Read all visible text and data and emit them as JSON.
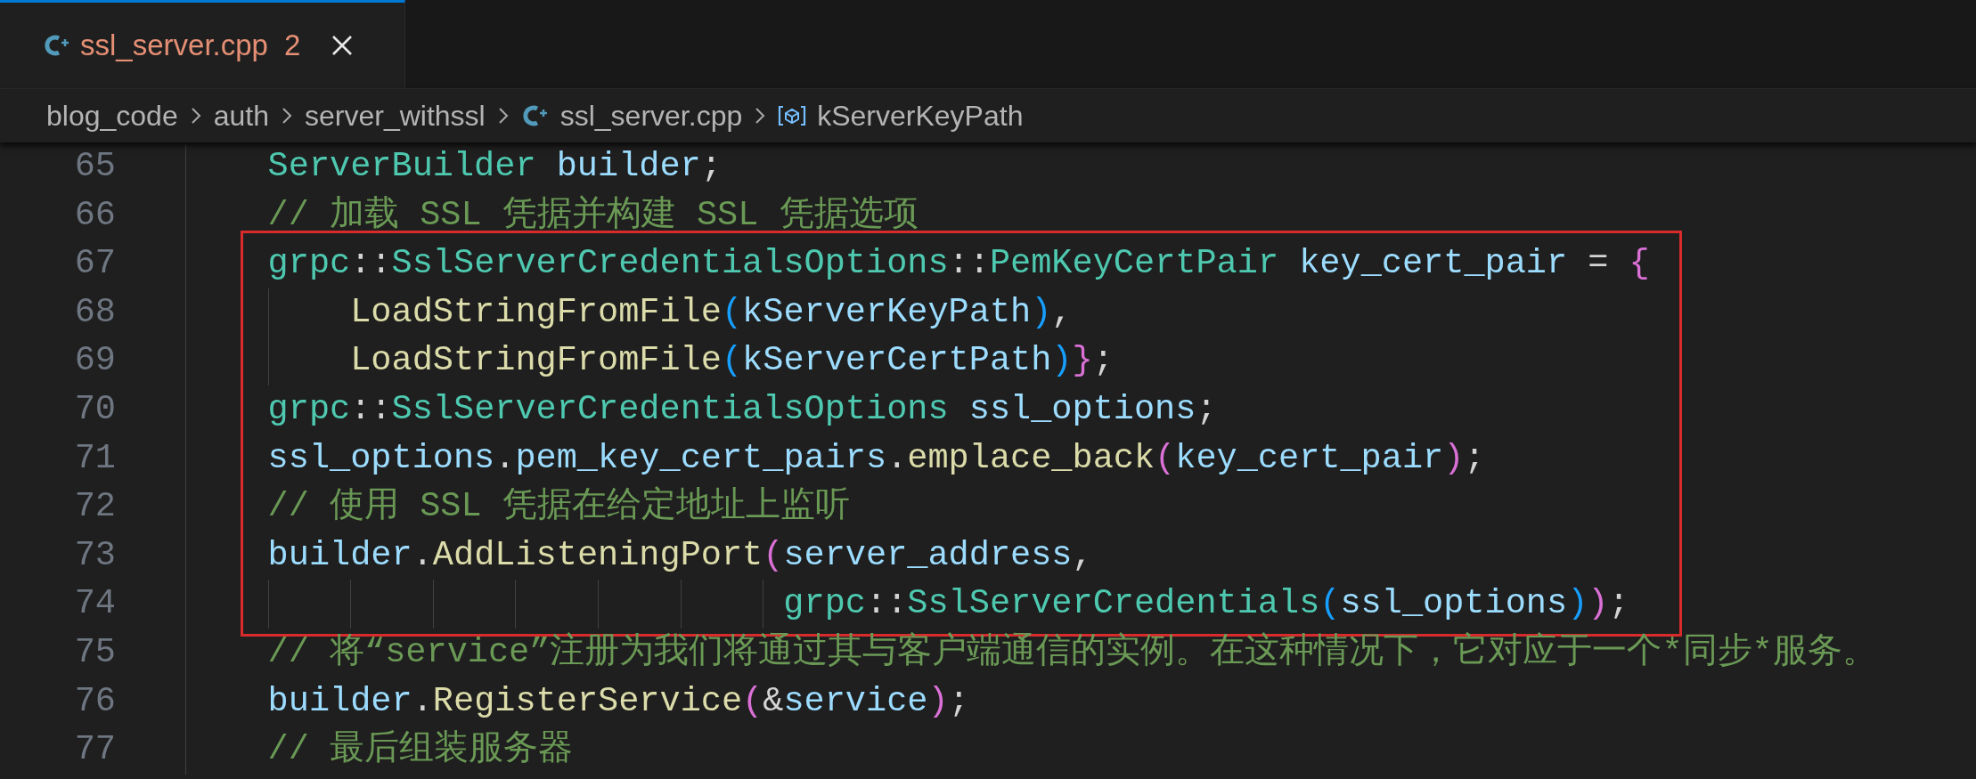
{
  "tab": {
    "label": "ssl_server.cpp",
    "problems": "2",
    "selected": true
  },
  "breadcrumbs": [
    {
      "label": "blog_code",
      "kind": "folder"
    },
    {
      "label": "auth",
      "kind": "folder"
    },
    {
      "label": "server_withssl",
      "kind": "folder"
    },
    {
      "label": "ssl_server.cpp",
      "kind": "cpp-file"
    },
    {
      "label": "kServerKeyPath",
      "kind": "variable"
    }
  ],
  "sections": [
    {
      "boxed": false,
      "lines": [
        {
          "number": "65",
          "tokens": [
            {
              "kind": "type",
              "text": "    ServerBuilder"
            },
            {
              "kind": "var",
              "text": " builder"
            },
            {
              "kind": "plain",
              "text": ";"
            }
          ]
        },
        {
          "number": "66",
          "tokens": [
            {
              "kind": "comment",
              "text": "    // 加载 SSL 凭据并构建 SSL 凭据选项"
            }
          ]
        }
      ]
    },
    {
      "boxed": true,
      "lines": [
        {
          "number": "67",
          "tokens": [
            {
              "kind": "type",
              "text": "    grpc"
            },
            {
              "kind": "plain",
              "text": "::"
            },
            {
              "kind": "type",
              "text": "SslServerCredentialsOptions"
            },
            {
              "kind": "plain",
              "text": "::"
            },
            {
              "kind": "type",
              "text": "PemKeyCertPair"
            },
            {
              "kind": "var",
              "text": " key_cert_pair"
            },
            {
              "kind": "plain",
              "text": " = "
            },
            {
              "kind": "bracket1",
              "text": "{"
            }
          ]
        },
        {
          "number": "68",
          "tokens": [
            {
              "kind": "func",
              "text": "        LoadStringFromFile"
            },
            {
              "kind": "bracket2",
              "text": "("
            },
            {
              "kind": "var",
              "text": "kServerKeyPath"
            },
            {
              "kind": "bracket2",
              "text": ")"
            },
            {
              "kind": "plain",
              "text": ","
            }
          ]
        },
        {
          "number": "69",
          "tokens": [
            {
              "kind": "func",
              "text": "        LoadStringFromFile"
            },
            {
              "kind": "bracket2",
              "text": "("
            },
            {
              "kind": "var",
              "text": "kServerCertPath"
            },
            {
              "kind": "bracket2",
              "text": ")"
            },
            {
              "kind": "bracket1",
              "text": "}"
            },
            {
              "kind": "plain",
              "text": ";"
            }
          ]
        },
        {
          "number": "70",
          "tokens": [
            {
              "kind": "type",
              "text": "    grpc"
            },
            {
              "kind": "plain",
              "text": "::"
            },
            {
              "kind": "type",
              "text": "SslServerCredentialsOptions"
            },
            {
              "kind": "var",
              "text": " ssl_options"
            },
            {
              "kind": "plain",
              "text": ";"
            }
          ]
        },
        {
          "number": "71",
          "tokens": [
            {
              "kind": "var",
              "text": "    ssl_options"
            },
            {
              "kind": "plain",
              "text": "."
            },
            {
              "kind": "var",
              "text": "pem_key_cert_pairs"
            },
            {
              "kind": "plain",
              "text": "."
            },
            {
              "kind": "func",
              "text": "emplace_back"
            },
            {
              "kind": "bracket1",
              "text": "("
            },
            {
              "kind": "var",
              "text": "key_cert_pair"
            },
            {
              "kind": "bracket1",
              "text": ")"
            },
            {
              "kind": "plain",
              "text": ";"
            }
          ]
        },
        {
          "number": "72",
          "tokens": [
            {
              "kind": "comment",
              "text": "    // 使用 SSL 凭据在给定地址上监听"
            }
          ]
        },
        {
          "number": "73",
          "tokens": [
            {
              "kind": "var",
              "text": "    builder"
            },
            {
              "kind": "plain",
              "text": "."
            },
            {
              "kind": "func",
              "text": "AddListeningPort"
            },
            {
              "kind": "bracket1",
              "text": "("
            },
            {
              "kind": "var",
              "text": "server_address"
            },
            {
              "kind": "plain",
              "text": ","
            }
          ]
        },
        {
          "number": "74",
          "tokens": [
            {
              "kind": "type",
              "text": "                             grpc"
            },
            {
              "kind": "plain",
              "text": "::"
            },
            {
              "kind": "type",
              "text": "SslServerCredentials"
            },
            {
              "kind": "bracket2",
              "text": "("
            },
            {
              "kind": "var",
              "text": "ssl_options"
            },
            {
              "kind": "bracket2",
              "text": ")"
            },
            {
              "kind": "bracket1",
              "text": ")"
            },
            {
              "kind": "plain",
              "text": ";"
            }
          ]
        }
      ]
    },
    {
      "boxed": false,
      "lines": [
        {
          "number": "75",
          "tokens": [
            {
              "kind": "comment",
              "text": "    // 将“service”注册为我们将通过其与客户端通信的实例。在这种情况下，它对应于一个*同步*服务。"
            }
          ]
        },
        {
          "number": "76",
          "tokens": [
            {
              "kind": "var",
              "text": "    builder"
            },
            {
              "kind": "plain",
              "text": "."
            },
            {
              "kind": "func",
              "text": "RegisterService"
            },
            {
              "kind": "bracket1",
              "text": "("
            },
            {
              "kind": "plain",
              "text": "&"
            },
            {
              "kind": "var",
              "text": "service"
            },
            {
              "kind": "bracket1",
              "text": ")"
            },
            {
              "kind": "plain",
              "text": ";"
            }
          ]
        },
        {
          "number": "77",
          "tokens": [
            {
              "kind": "comment",
              "text": "    // 最后组装服务器"
            }
          ]
        }
      ]
    }
  ]
}
